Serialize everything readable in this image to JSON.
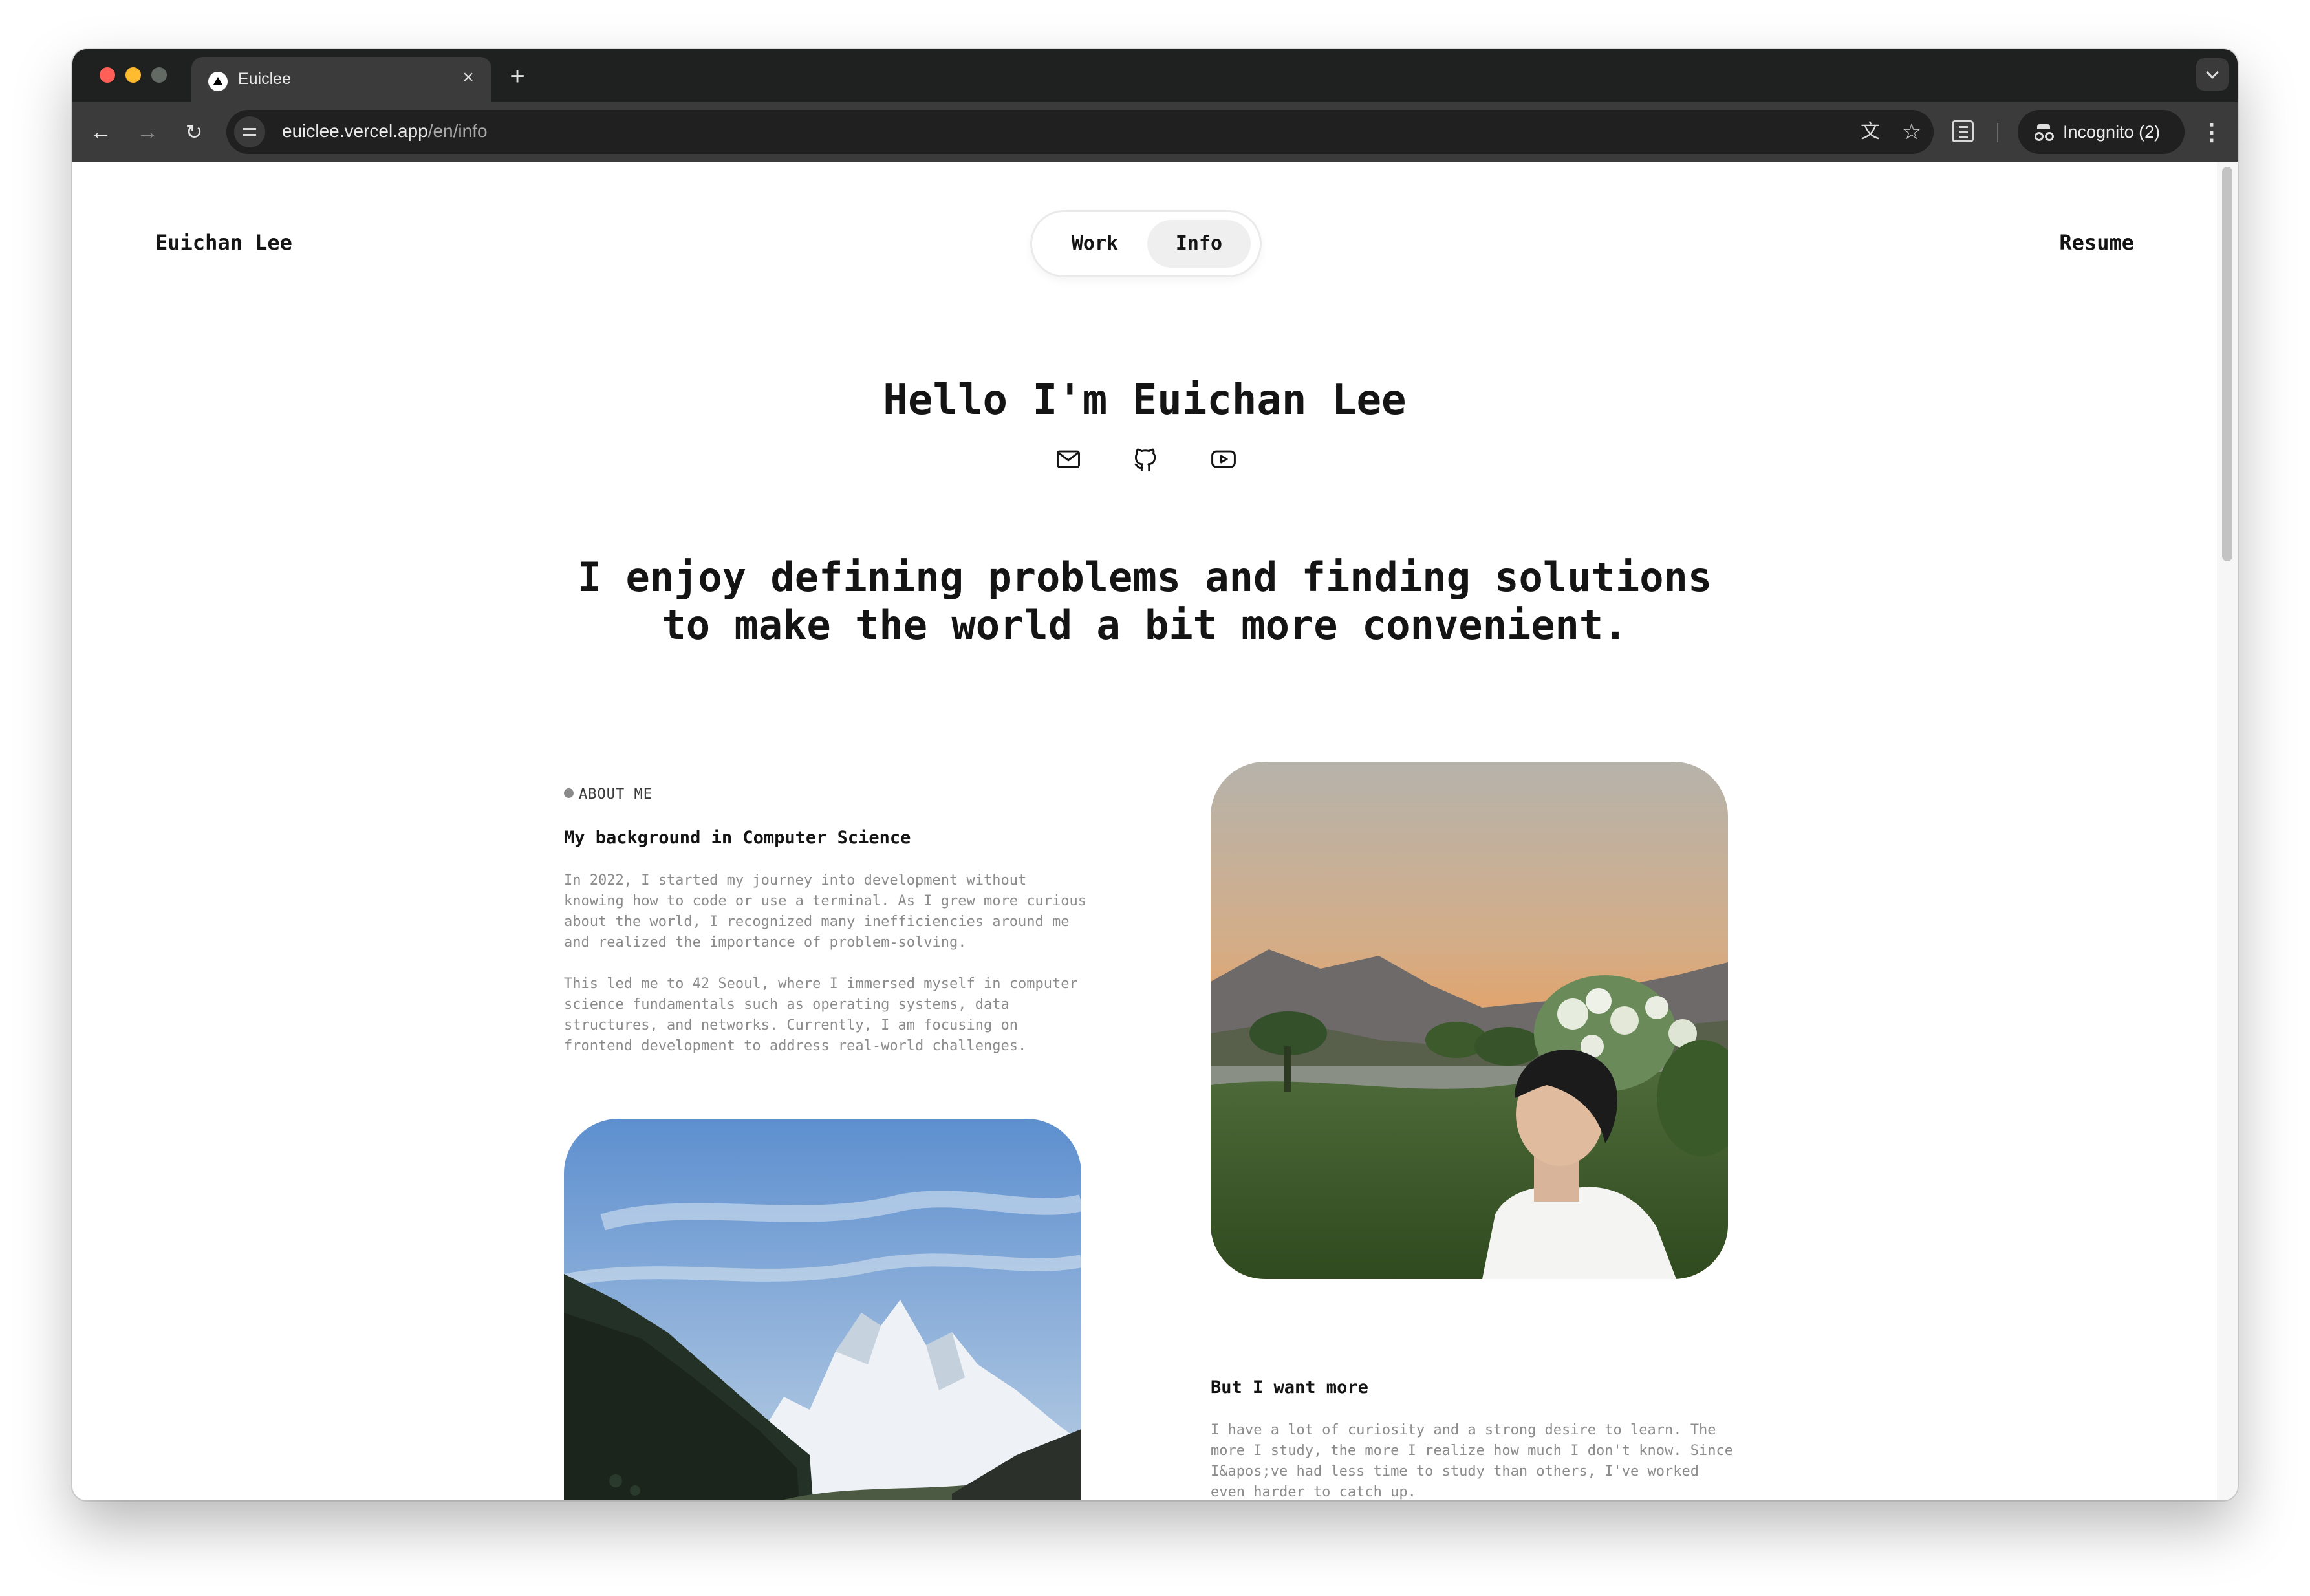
{
  "browser": {
    "tab_title": "Euiclee",
    "tab_close": "×",
    "new_tab": "+",
    "url_host": "euiclee.vercel.app",
    "url_path": "/en/info",
    "incognito_label": "Incognito (2)",
    "icons": [
      "back-arrow-icon",
      "forward-arrow-icon",
      "reload-icon",
      "site-info-icon",
      "translate-icon",
      "star-icon",
      "reader-mode-icon",
      "incognito-icon",
      "more-menu-icon",
      "tab-search-icon"
    ]
  },
  "header": {
    "brand": "Euichan Lee",
    "nav": {
      "work": "Work",
      "info": "Info",
      "active": "Info"
    },
    "resume": "Resume"
  },
  "hero": {
    "greeting": "Hello I'm Euichan Lee",
    "social_icons": [
      "mail-icon",
      "github-icon",
      "youtube-icon"
    ],
    "headline_line1": "I enjoy defining problems and finding solutions",
    "headline_line2": "to make the world a bit more convenient."
  },
  "about": {
    "label": "ABOUT ME",
    "background_title": "My background in Computer Science",
    "background_p1": "In 2022, I started my journey into development without knowing how to code or use a terminal. As I grew more curious about the world, I recognized many inefficiencies around me and realized the importance of problem-solving.",
    "background_p2": "This led me to 42 Seoul, where I immersed myself in computer science fundamentals such as operating systems, data structures, and networks. Currently, I am focusing on frontend development to address real-world challenges.",
    "more_title": "But I want more",
    "more_p1": "I have a lot of curiosity and a strong desire to learn. The more I study, the more I realize how much I don't know. Since I&apos;ve had less time to study than others, I've worked even harder to catch up."
  },
  "colors": {
    "text": "#141414",
    "muted_text": "#8c8c8c",
    "tab_bar": "#1f2020",
    "toolbar": "#3b3b3b",
    "active_pill": "#efefef"
  }
}
